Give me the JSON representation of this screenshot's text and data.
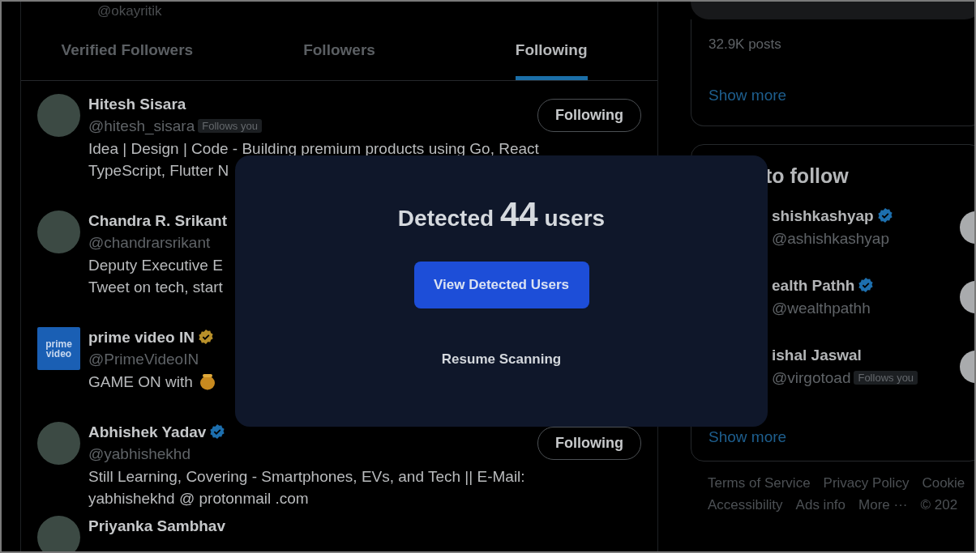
{
  "profile": {
    "handle": "@okayritik"
  },
  "tabs": [
    {
      "label": "Verified Followers",
      "selected": false
    },
    {
      "label": "Followers",
      "selected": false
    },
    {
      "label": "Following",
      "selected": true
    }
  ],
  "users": [
    {
      "kind": "person",
      "name": "Hitesh Sisara",
      "handle": "@hitesh_sisara",
      "follows_you": "Follows you",
      "bio": [
        "Idea | Design | Code - Building premium products using Go, React",
        "TypeScript, Flutter N"
      ],
      "button": "Following"
    },
    {
      "kind": "person",
      "name": "Chandra R. Srikant",
      "handle": "@chandrarsrikant",
      "bio": [
        "Deputy Executive E",
        "Tweet on tech, start"
      ]
    },
    {
      "kind": "logo",
      "name": "prime video IN",
      "handle": "@PrimeVideoIN",
      "verified_badge": {
        "color": "#b8902a"
      },
      "avatar_text": "prime video",
      "bio": [
        "GAME ON with"
      ]
    },
    {
      "kind": "person",
      "name": "Abhishek Yadav",
      "handle": "@yabhishekhd",
      "verified_badge": {
        "color": "#1d6fae"
      },
      "bio": [
        "Still Learning, Covering - Smartphones, EVs, and Tech || E-Mail:",
        "yabhishekhd @ protonmail .com"
      ],
      "button": "Following"
    },
    {
      "kind": "person",
      "name": "Priyanka Sambhav"
    }
  ],
  "trends": {
    "posts": "32.9K posts",
    "show_more": "Show more"
  },
  "who_to_follow": {
    "title": "to follow",
    "users": [
      {
        "name": "shishkashyap",
        "handle": "@ashishkashyap",
        "verified_badge": {
          "color": "#1d6fae"
        }
      },
      {
        "name": "ealth Pathh",
        "handle": "@wealthpathh",
        "verified_badge": {
          "color": "#1d6fae"
        }
      },
      {
        "name": "ishal Jaswal",
        "handle": "@virgotoad",
        "follows_you": "Follows you"
      }
    ],
    "show_more": "Show more"
  },
  "footer": {
    "links": [
      "Terms of Service",
      "Privacy Policy",
      "Cookie",
      "Accessibility",
      "Ads info",
      "More ···",
      "© 202"
    ]
  },
  "dialog": {
    "title_prefix": "Detected",
    "count": "44",
    "title_suffix": "users",
    "primary_button": "View Detected Users",
    "secondary_button": "Resume Scanning"
  }
}
